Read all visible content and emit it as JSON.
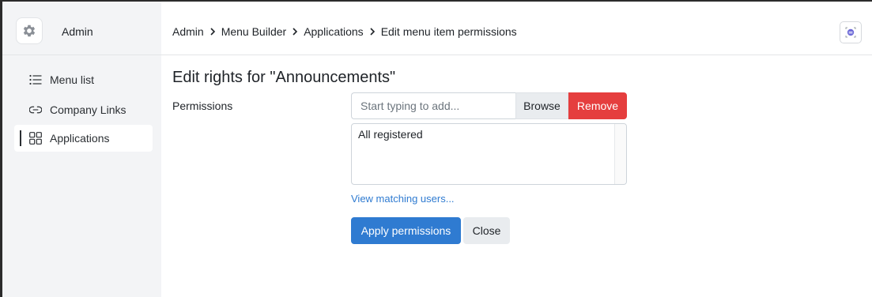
{
  "brand": {
    "name": "Admin",
    "logo_icon": "gear-icon"
  },
  "sidebar": {
    "items": [
      {
        "label": "Menu list",
        "icon": "list-icon",
        "active": false
      },
      {
        "label": "Company Links",
        "icon": "link-icon",
        "active": false
      },
      {
        "label": "Applications",
        "icon": "grid-icon",
        "active": true
      }
    ]
  },
  "breadcrumb": {
    "items": [
      "Admin",
      "Menu Builder",
      "Applications",
      "Edit menu item permissions"
    ],
    "separator_icon": "chevron-right-icon"
  },
  "header": {
    "action_icon": "chat-bubble-icon"
  },
  "main": {
    "title": "Edit rights for \"Announcements\"",
    "permissions_label": "Permissions",
    "search": {
      "placeholder": "Start typing to add...",
      "value": ""
    },
    "browse_label": "Browse",
    "remove_label": "Remove",
    "selected_permissions": [
      "All registered"
    ],
    "view_users_link": "View matching users...",
    "apply_label": "Apply permissions",
    "close_label": "Close"
  },
  "colors": {
    "primary": "#2f7bd1",
    "danger": "#e53e3e",
    "sidebar_bg": "#f3f4f6",
    "secondary_btn": "#e9ecef"
  }
}
